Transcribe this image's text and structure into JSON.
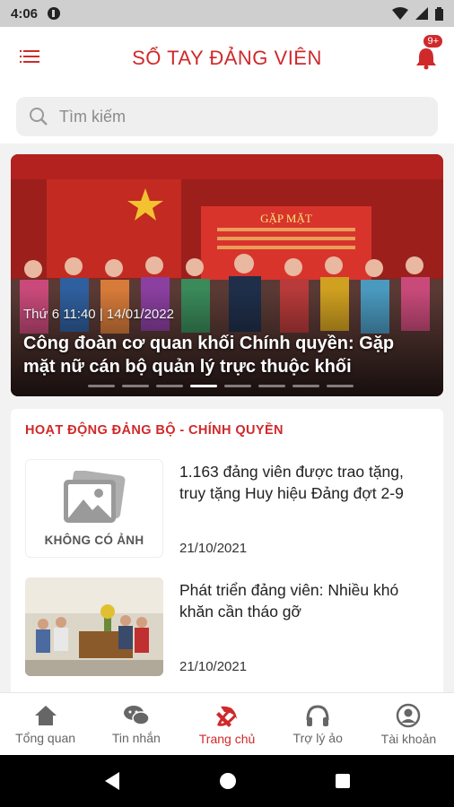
{
  "status_bar": {
    "time": "4:06"
  },
  "app_bar": {
    "title": "SỔ TAY ĐẢNG VIÊN",
    "notification_badge": "9+"
  },
  "search": {
    "placeholder": "Tìm kiếm"
  },
  "banner": {
    "sign_text": "GẶP MẶT",
    "meta": "Thứ 6  11:40 | 14/01/2022",
    "headline": "Công đoàn cơ quan khối Chính quyền: Gặp mặt nữ cán bộ quản lý trực thuộc khối",
    "slide_count": 8,
    "active_slide": 4
  },
  "section": {
    "title": "HOẠT ĐỘNG ĐẢNG BỘ - CHÍNH QUYỀN",
    "articles": [
      {
        "title": "1.163 đảng viên được trao tặng, truy tặng Huy hiệu Đảng đợt 2-9",
        "date": "21/10/2021",
        "no_image_label": "KHÔNG CÓ ẢNH"
      },
      {
        "title": "Phát triển đảng viên: Nhiều khó khăn cần tháo gỡ",
        "date": "21/10/2021"
      }
    ]
  },
  "bottom_nav": [
    {
      "label": "Tổng quan",
      "icon": "home-icon"
    },
    {
      "label": "Tin nhắn",
      "icon": "chat-icon"
    },
    {
      "label": "Trang chủ",
      "icon": "hammer-sickle-icon",
      "active": true
    },
    {
      "label": "Trợ lý ảo",
      "icon": "headphones-icon"
    },
    {
      "label": "Tài khoản",
      "icon": "account-icon"
    }
  ],
  "colors": {
    "accent": "#d0292a",
    "background": "#f2f2f2"
  }
}
